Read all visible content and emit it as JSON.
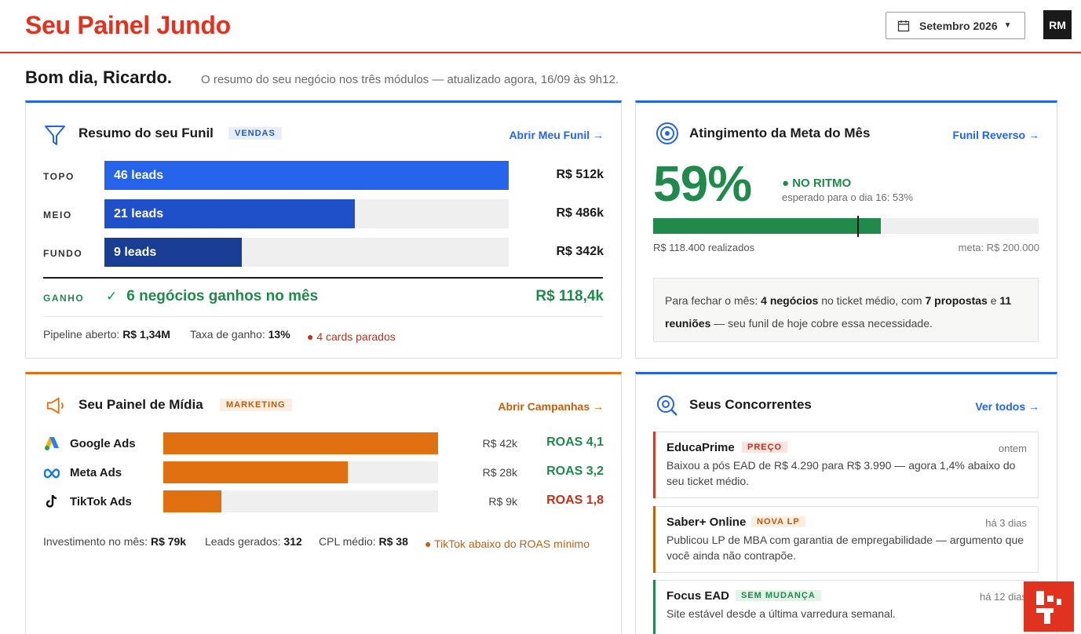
{
  "header": {
    "brand": "Seu Painel Jundo",
    "month": "Setembro 2026",
    "avatar": "RM"
  },
  "greeting": {
    "title": "Bom dia, Ricardo.",
    "subtitle": "O resumo do seu negócio nos três módulos — atualizado agora, 16/09 às 9h12."
  },
  "funnel": {
    "title": "Resumo do seu Funil",
    "tag": "VENDAS",
    "link": "Abrir Meu Funil →",
    "rows": [
      {
        "stage": "TOPO",
        "leads": "46 leads",
        "value": "R$ 512k",
        "fill": 1.0,
        "color": "#2563eb"
      },
      {
        "stage": "MEIO",
        "leads": "21 leads",
        "value": "R$ 486k",
        "fill": 0.62,
        "color": "#1f4fc9"
      },
      {
        "stage": "FUNDO",
        "leads": "9 leads",
        "value": "R$ 342k",
        "fill": 0.34,
        "color": "#1a3d94"
      }
    ],
    "won_label": "GANHO",
    "won_text": "6 negócios ganhos no mês",
    "won_value": "R$ 118,4k",
    "pipeline_label": "Pipeline aberto:",
    "pipeline_value": "R$ 1,34M",
    "rate_label": "Taxa de ganho:",
    "rate_value": "13%",
    "alert": "● 4 cards parados"
  },
  "goal": {
    "title": "Atingimento da Meta do Mês",
    "link": "Funil Reverso →",
    "percent": "59%",
    "percent_value": 0.59,
    "expected_value": 0.53,
    "status": "● NO RITMO",
    "status_sub": "esperado para o dia 16: 53%",
    "realized": "R$ 118.400 realizados",
    "target": "meta: R$ 200.000",
    "note": {
      "p1": "Para fechar o mês: ",
      "b1": "4 negócios",
      "p2": " no ticket médio, com ",
      "b2": "7 propostas",
      "p3": " e ",
      "b3": "11 reuniões",
      "p4": " — seu funil de hoje cobre essa necessidade."
    }
  },
  "media": {
    "title": "Seu Painel de Mídia",
    "tag": "MARKETING",
    "link": "Abrir Campanhas →",
    "channels": [
      {
        "name": "Google Ads",
        "icon": "google-ads-icon",
        "spend": "R$ 42k",
        "roas": "ROAS 4,1",
        "fill": 1.0,
        "roas_color": "#1f8a4c"
      },
      {
        "name": "Meta Ads",
        "icon": "meta-icon",
        "spend": "R$ 28k",
        "roas": "ROAS 3,2",
        "fill": 0.67,
        "roas_color": "#1f8a4c"
      },
      {
        "name": "TikTok Ads",
        "icon": "tiktok-icon",
        "spend": "R$ 9k",
        "roas": "ROAS 1,8",
        "fill": 0.21,
        "roas_color": "#c0301a"
      }
    ],
    "invest_label": "Investimento no mês:",
    "invest_value": "R$ 79k",
    "leads_label": "Leads gerados:",
    "leads_value": "312",
    "cpl_label": "CPL médio:",
    "cpl_value": "R$ 38",
    "alert": "● TikTok abaixo do ROAS mínimo"
  },
  "competitors": {
    "title": "Seus Concorrentes",
    "link": "Ver todos →",
    "items": [
      {
        "name": "EducaPrime",
        "tag": "PREÇO",
        "time": "ontem",
        "desc": "Baixou a pós EAD de R$ 4.290 para R$ 3.990 — agora 1,4% abaixo do seu ticket médio.",
        "bar": "#d63a2a",
        "tag_bg": "#fde4e0",
        "tag_fg": "#c0301a"
      },
      {
        "name": "Saber+ Online",
        "tag": "NOVA LP",
        "time": "há 3 dias",
        "desc": "Publicou LP de MBA com garantia de empregabilidade — argumento que você ainda não contrapõe.",
        "bar": "#c2600e",
        "tag_bg": "#fdeee0",
        "tag_fg": "#b85a10"
      },
      {
        "name": "Focus EAD",
        "tag": "SEM MUDANÇA",
        "time": "há 12 dias",
        "desc": "Site estável desde a última varredura semanal.",
        "bar": "#1f8a4c",
        "tag_bg": "#e2f4e8",
        "tag_fg": "#1f8a4c"
      }
    ]
  }
}
